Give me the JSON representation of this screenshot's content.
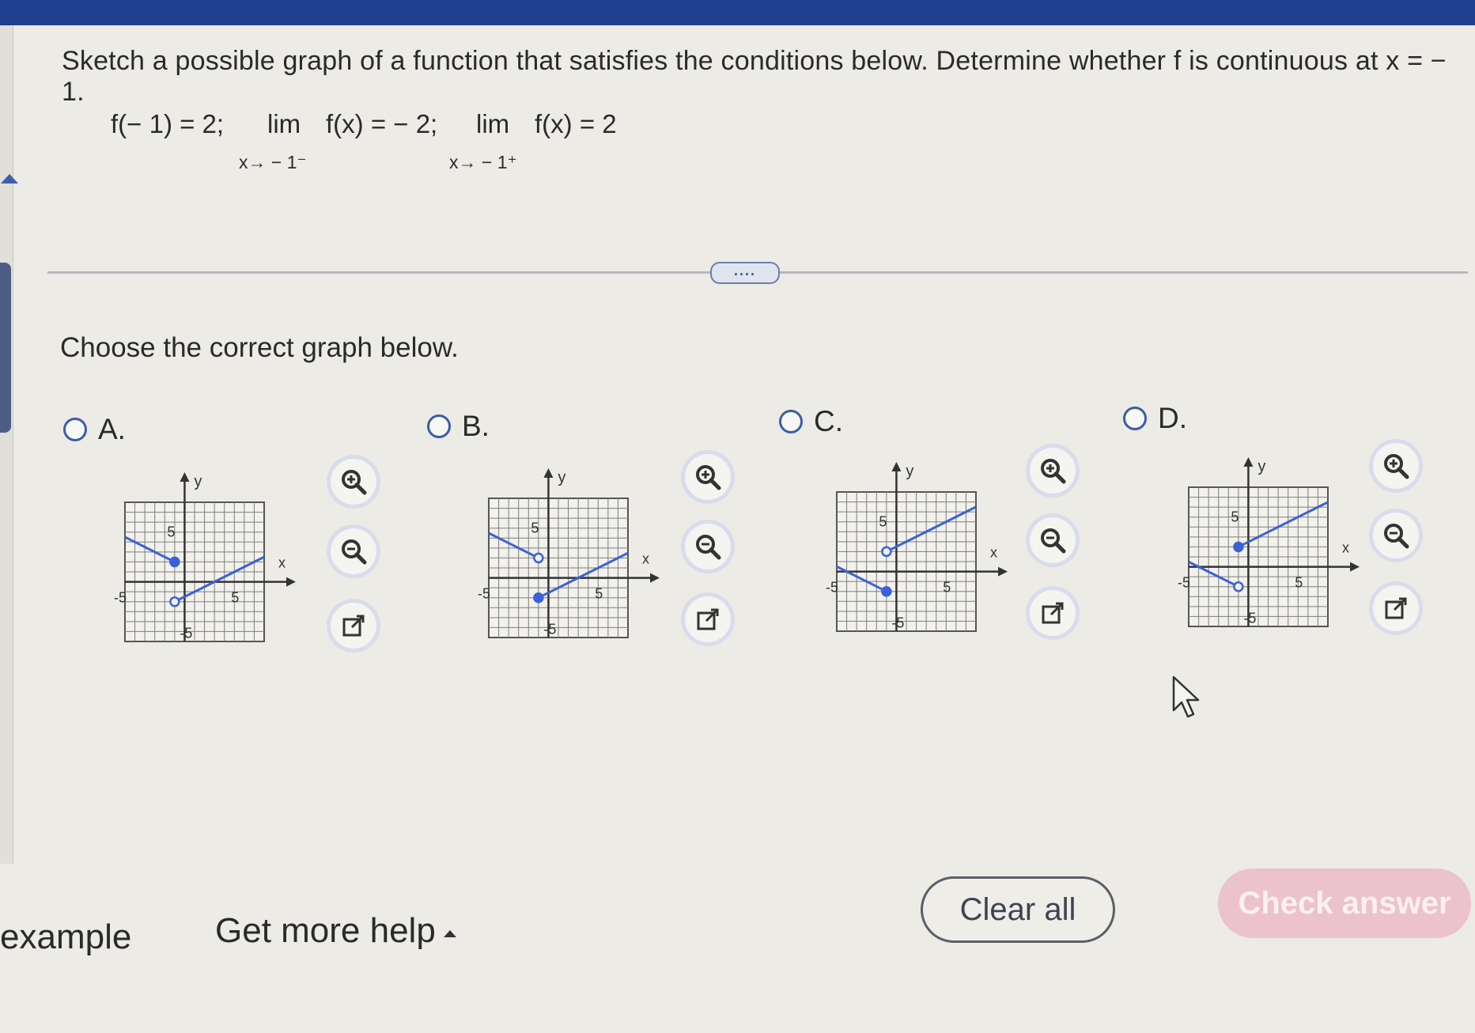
{
  "question": {
    "text": "Sketch a possible graph of a function that satisfies the conditions below. Determine whether f is continuous at x = − 1.",
    "value_condition": "f(− 1) = 2;",
    "lim_word": "lim",
    "left_limit_expr": "f(x) = − 2;",
    "left_limit_sub": "x→ − 1⁻",
    "right_limit_expr": "f(x) = 2",
    "right_limit_sub": "x→ − 1⁺"
  },
  "divider": {
    "more_label": "...."
  },
  "prompt": "Choose the correct graph below.",
  "options": [
    {
      "letter": "A.",
      "left": {
        "y_at_minus1": 2,
        "closed": true
      },
      "right": {
        "y_at_minus1": -2,
        "closed": false
      }
    },
    {
      "letter": "B.",
      "left": {
        "y_at_minus1": 2,
        "closed": false
      },
      "right": {
        "y_at_minus1": -2,
        "closed": true
      }
    },
    {
      "letter": "C.",
      "left": {
        "y_at_minus1": -2,
        "closed": true
      },
      "right": {
        "y_at_minus1": 2,
        "closed": false
      }
    },
    {
      "letter": "D.",
      "left": {
        "y_at_minus1": -2,
        "closed": false
      },
      "right": {
        "y_at_minus1": 2,
        "closed": true
      }
    }
  ],
  "graph_labels": {
    "x": "x",
    "y": "y",
    "pos": "5",
    "neg": "-5"
  },
  "tools": {
    "zoom_in": "zoom-in-icon",
    "zoom_out": "zoom-out-icon",
    "open": "open-external-icon"
  },
  "footer": {
    "example_label": "example",
    "help_label": "Get more help",
    "clear_label": "Clear all",
    "check_label": "Check answer"
  },
  "colors": {
    "accent": "#3a5ea6",
    "line": "#3a62d6",
    "check_disabled": "#ecc2cc",
    "topbar": "#1f3f8f"
  }
}
